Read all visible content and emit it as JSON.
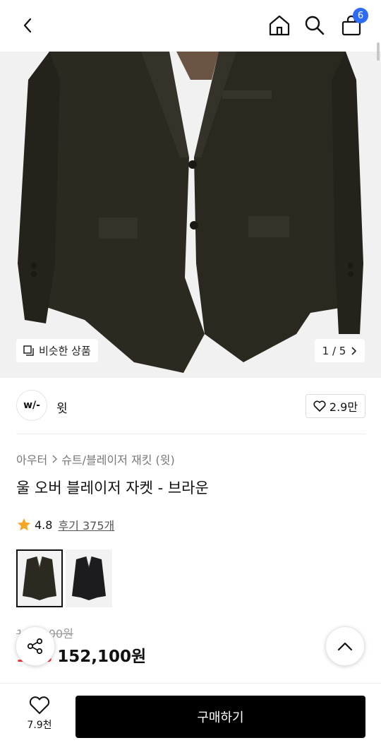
{
  "header": {
    "cart_count": "6",
    "icons": [
      "back-arrow-icon",
      "home-icon",
      "search-icon",
      "shopping-bag-icon"
    ]
  },
  "hero": {
    "similar_label": "비슷한 상품",
    "pager": "1 / 5"
  },
  "brand": {
    "logo_text": "w/-",
    "name": "윗",
    "likes": "2.9만"
  },
  "product": {
    "breadcrumb": [
      "아우터",
      "슈트/블레이저 재킷 (윗)"
    ],
    "title": "울 오버 블레이저 자켓 - 브라운",
    "rating": "4.8",
    "reviews": "후기 375개",
    "original_price": "169,000원",
    "discount": "10%",
    "sale_price": "152,100원"
  },
  "bottom": {
    "wish_count": "7.9천",
    "buy_label": "구매하기"
  },
  "colors": {
    "accent": "#2f6cf6",
    "discount": "#f02d2d",
    "star": "#f5a623",
    "jacket_brown": "#2c2a20"
  }
}
